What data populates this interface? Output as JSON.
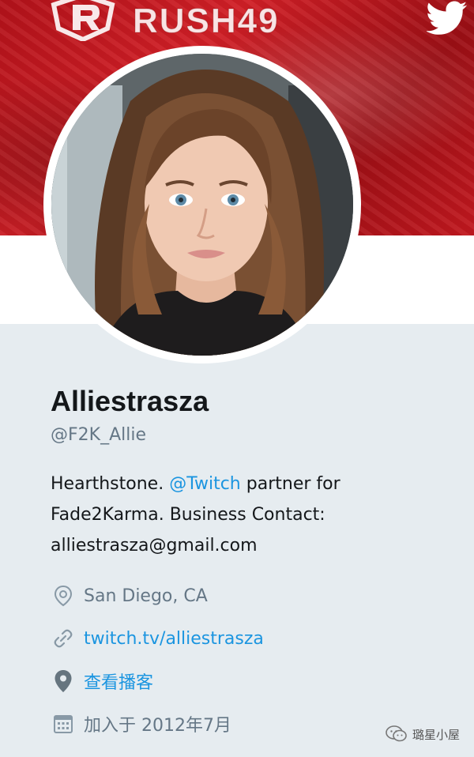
{
  "banner": {
    "brand_name": "RUSH49",
    "brand_logo_icon": "rush-r-logo-icon",
    "social_icon": "twitter-bird-icon",
    "accent": "#c2181f"
  },
  "profile": {
    "display_name": "Alliestrasza",
    "handle": "@F2K_Allie",
    "bio_part1": "Hearthstone. ",
    "bio_mention": "@Twitch",
    "bio_part2": " partner for Fade2Karma. Business Contact: alliestrasza@gmail.com",
    "location": "San Diego, CA",
    "website": "twitch.tv/alliestrasza",
    "live_label": "查看播客",
    "joined": "加入于 2012年7月"
  },
  "colors": {
    "link": "#1b95e0",
    "muted": "#657786",
    "text": "#14171a",
    "background": "#e6ecf0"
  },
  "watermark": {
    "text": "璐星小屋",
    "icon": "wechat-icon"
  }
}
